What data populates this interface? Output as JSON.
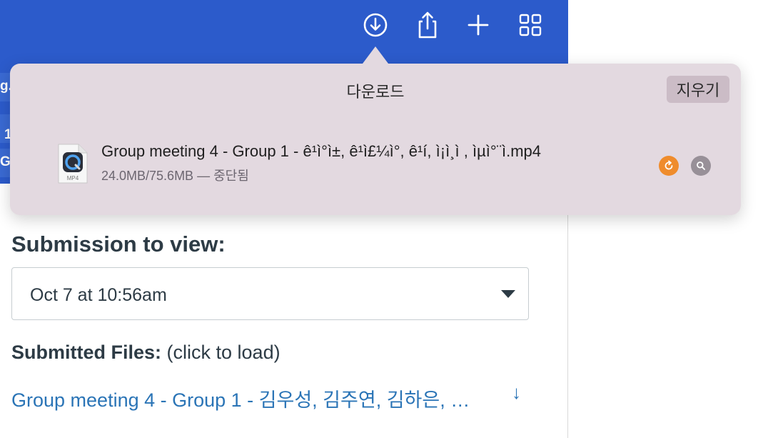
{
  "toolbar": {
    "icons": [
      "download-icon",
      "share-icon",
      "plus-icon",
      "tab-overview-icon"
    ],
    "color": "#2c5bcb"
  },
  "tabs": {
    "ghost_1": "g.",
    "ghost_2": "1",
    "ghost_3": "G"
  },
  "downloads": {
    "title": "다운로드",
    "clear_label": "지우기",
    "items": [
      {
        "file_type": "MP4",
        "name": "Group meeting 4 - Group 1 - ê¹ì°ì±, ê¹ì£¼ì°, ê¹í, ì¡ì¸ì , ìµì°¨ì.mp4",
        "status": "24.0MB/75.6MB — 중단됨",
        "resume_color": "#ef8c2c"
      }
    ]
  },
  "submission": {
    "label": "Submission to view:",
    "selected": "Oct 7 at 10:56am",
    "files_label": "Submitted Files:",
    "files_hint": "(click to load)",
    "file_link": "Group meeting 4 - Group 1 - 김우성, 김주연, 김하은, …",
    "download_arrow": "↓"
  }
}
